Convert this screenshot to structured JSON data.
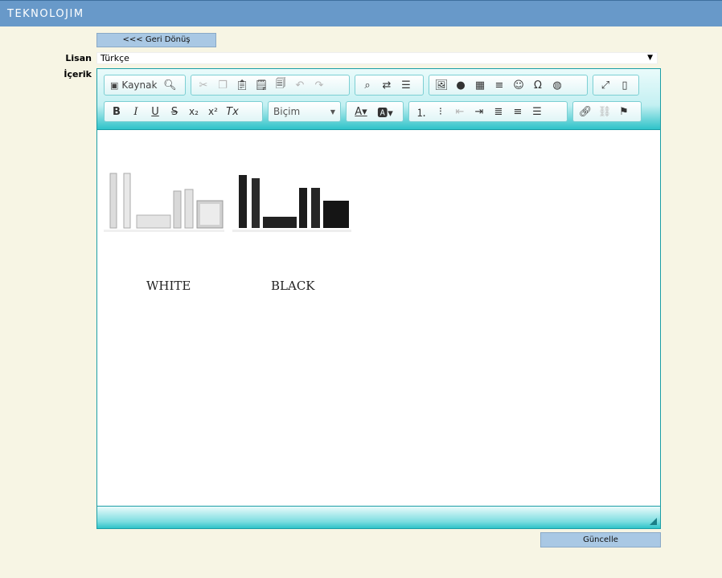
{
  "header": {
    "logo_text": "TEKNOLOJIM"
  },
  "back_button": {
    "label": "<<< Geri Dönüş"
  },
  "form": {
    "language_label": "Lisan",
    "language_value": "Türkçe",
    "content_label": "İçerik"
  },
  "toolbar": {
    "source_label": "Kaynak",
    "format_label": "Biçim"
  },
  "content": {
    "captions": [
      "WHITE",
      "BLACK"
    ]
  },
  "save_button": {
    "label": "Güncelle"
  },
  "colors": {
    "header": "#6899c9",
    "accent": "#1b9ea6",
    "button": "#a9c8e4",
    "background": "#f7f5e4"
  }
}
